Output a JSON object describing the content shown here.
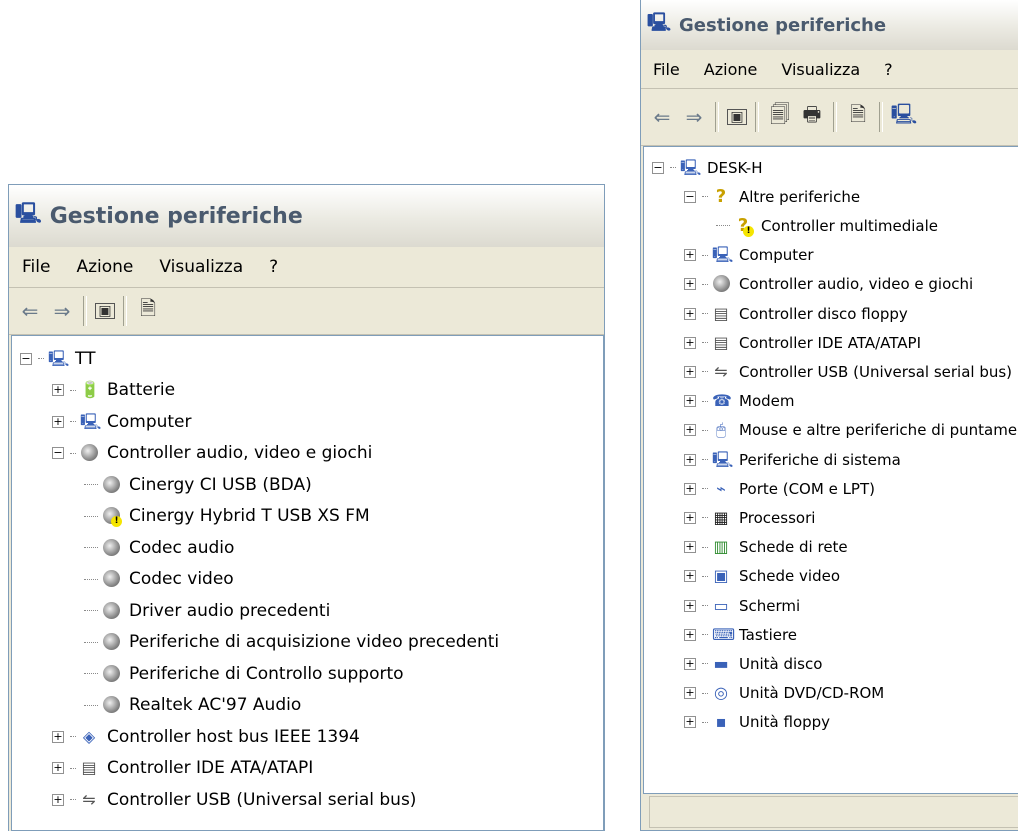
{
  "left_window": {
    "title": "Gestione periferiche",
    "menu": [
      "File",
      "Azione",
      "Visualizza",
      "?"
    ],
    "tree": [
      {
        "label": "TT",
        "icon": "computer-icon",
        "level": 0,
        "expander": "minus"
      },
      {
        "label": "Batterie",
        "icon": "battery-icon",
        "level": 1,
        "expander": "plus"
      },
      {
        "label": "Computer",
        "icon": "computer-icon",
        "level": 1,
        "expander": "plus"
      },
      {
        "label": "Controller audio, video e giochi",
        "icon": "audio-device-icon",
        "level": 1,
        "expander": "minus"
      },
      {
        "label": "Cinergy CI USB (BDA)",
        "icon": "audio-device-icon",
        "level": 2
      },
      {
        "label": "Cinergy Hybrid T USB XS FM",
        "icon": "audio-device-warning-icon",
        "level": 2
      },
      {
        "label": "Codec audio",
        "icon": "audio-device-icon",
        "level": 2
      },
      {
        "label": "Codec video",
        "icon": "audio-device-icon",
        "level": 2
      },
      {
        "label": "Driver audio precedenti",
        "icon": "audio-device-icon",
        "level": 2
      },
      {
        "label": "Periferiche di acquisizione video precedenti",
        "icon": "audio-device-icon",
        "level": 2
      },
      {
        "label": "Periferiche di Controllo supporto",
        "icon": "audio-device-icon",
        "level": 2
      },
      {
        "label": "Realtek AC'97 Audio",
        "icon": "audio-device-icon",
        "level": 2
      },
      {
        "label": "Controller host bus IEEE 1394",
        "icon": "ieee1394-icon",
        "level": 1,
        "expander": "plus"
      },
      {
        "label": "Controller IDE ATA/ATAPI",
        "icon": "ide-controller-icon",
        "level": 1,
        "expander": "plus"
      },
      {
        "label": "Controller USB (Universal serial bus)",
        "icon": "usb-icon",
        "level": 1,
        "expander": "plus"
      }
    ]
  },
  "right_window": {
    "title": "Gestione periferiche",
    "menu": [
      "File",
      "Azione",
      "Visualizza",
      "?"
    ],
    "tree": [
      {
        "label": "DESK-H",
        "icon": "computer-icon",
        "level": 0,
        "expander": "minus"
      },
      {
        "label": "Altre periferiche",
        "icon": "unknown-device-icon",
        "level": 1,
        "expander": "minus"
      },
      {
        "label": "Controller multimediale",
        "icon": "unknown-device-warning-icon",
        "level": 2
      },
      {
        "label": "Computer",
        "icon": "computer-icon",
        "level": 1,
        "expander": "plus"
      },
      {
        "label": "Controller audio, video e giochi",
        "icon": "audio-device-icon",
        "level": 1,
        "expander": "plus"
      },
      {
        "label": "Controller disco floppy",
        "icon": "floppy-controller-icon",
        "level": 1,
        "expander": "plus"
      },
      {
        "label": "Controller IDE ATA/ATAPI",
        "icon": "ide-controller-icon",
        "level": 1,
        "expander": "plus"
      },
      {
        "label": "Controller USB (Universal serial bus)",
        "icon": "usb-icon",
        "level": 1,
        "expander": "plus"
      },
      {
        "label": "Modem",
        "icon": "modem-icon",
        "level": 1,
        "expander": "plus"
      },
      {
        "label": "Mouse e altre periferiche di puntamento",
        "icon": "mouse-icon",
        "level": 1,
        "expander": "plus"
      },
      {
        "label": "Periferiche di sistema",
        "icon": "system-device-icon",
        "level": 1,
        "expander": "plus"
      },
      {
        "label": "Porte (COM e LPT)",
        "icon": "port-icon",
        "level": 1,
        "expander": "plus"
      },
      {
        "label": "Processori",
        "icon": "processor-icon",
        "level": 1,
        "expander": "plus"
      },
      {
        "label": "Schede di rete",
        "icon": "network-card-icon",
        "level": 1,
        "expander": "plus"
      },
      {
        "label": "Schede video",
        "icon": "display-adapter-icon",
        "level": 1,
        "expander": "plus"
      },
      {
        "label": "Schermi",
        "icon": "monitor-icon",
        "level": 1,
        "expander": "plus"
      },
      {
        "label": "Tastiere",
        "icon": "keyboard-icon",
        "level": 1,
        "expander": "plus"
      },
      {
        "label": "Unità disco",
        "icon": "disk-drive-icon",
        "level": 1,
        "expander": "plus"
      },
      {
        "label": "Unità DVD/CD-ROM",
        "icon": "cdrom-icon",
        "level": 1,
        "expander": "plus"
      },
      {
        "label": "Unità floppy",
        "icon": "floppy-drive-icon",
        "level": 1,
        "expander": "plus"
      }
    ]
  }
}
